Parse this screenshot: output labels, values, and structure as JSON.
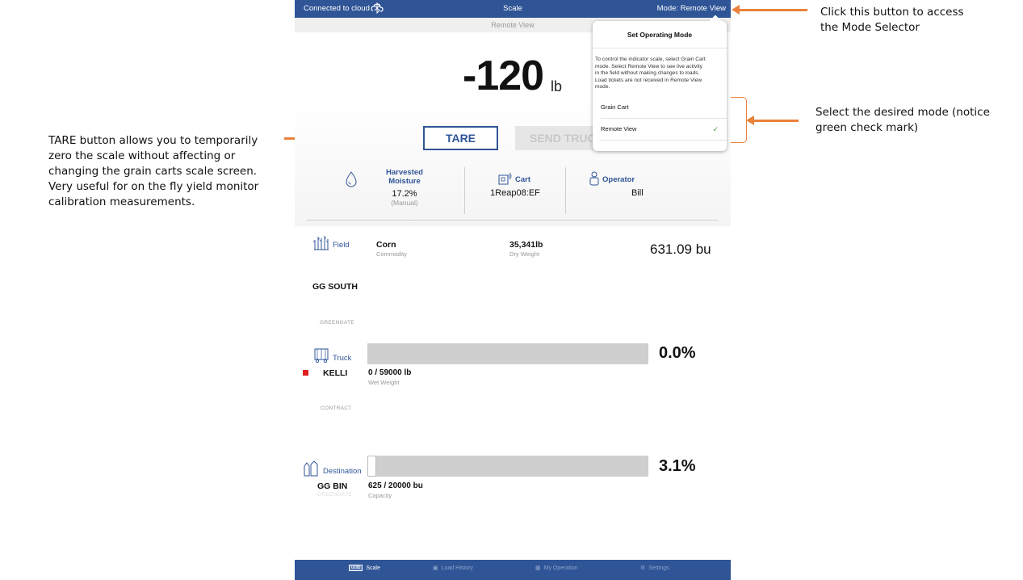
{
  "annotations": {
    "mode_selector_line1": "Click this button to access",
    "mode_selector_line2": "the Mode Selector",
    "mode_notice_line1": "Select the desired mode (notice",
    "mode_notice_line2": "green check mark)",
    "tare_lines": [
      "TARE button allows you to temporarily",
      "zero the scale without affecting or",
      "changing the grain carts scale screen.",
      "Very useful for on the fly yield monitor",
      "calibration measurements."
    ],
    "accent_color": "#e9823a"
  },
  "topbar": {
    "connection": "Connected to cloud",
    "title": "Scale",
    "mode_button": "Mode: Remote View",
    "color": "#2f5597"
  },
  "subbar": {
    "label": "Remote View"
  },
  "scale": {
    "weight": "-120",
    "unit": "lb",
    "tare_label": "TARE",
    "send_label": "SEND TRUCK"
  },
  "info": {
    "moisture_label_1": "Harvested",
    "moisture_label_2": "Moisture",
    "moisture_value": "17.2%",
    "moisture_sub": "(Manual)",
    "cart_label": "Cart",
    "cart_value": "1Reap08:EF",
    "operator_label": "Operator",
    "operator_value": "Bill"
  },
  "field": {
    "label": "Field",
    "commodity": "Corn",
    "commodity_sub": "Commodity",
    "dry_weight": "35,341lb",
    "dry_weight_sub": "Dry Weight",
    "bushels": "631.09 bu",
    "name": "GG SOUTH",
    "farm": "GREENGATE"
  },
  "truck": {
    "label": "Truck",
    "name": "KELLI",
    "weight": "0 / 59000 lb",
    "weight_sub": "Wet Weight",
    "contract": "CONTRACT",
    "percent": "0.0%",
    "fill_fraction": 0.0,
    "indicator_color": "#e02020"
  },
  "destination": {
    "label": "Destination",
    "name": "GG BIN",
    "farm": "GREENGATE",
    "capacity": "625 / 20000 bu",
    "capacity_sub": "Capacity",
    "percent": "3.1%",
    "fill_fraction": 0.031
  },
  "nav": {
    "scale_badge": "00lb",
    "scale": "Scale",
    "load_history": "Load History",
    "my_operation": "My Operation",
    "settings": "Settings"
  },
  "popover": {
    "title": "Set Operating Mode",
    "desc_lines": [
      "To control the indicator scale, select Grain Cart",
      "mode.  Select Remote View to see live activity",
      "in the field without making changes to loads.",
      "Load tickets are not received in Remote View",
      "mode."
    ],
    "option_grain_cart": "Grain Cart",
    "option_remote_view": "Remote View",
    "selected": "Remote View",
    "check_color": "#43a047"
  }
}
